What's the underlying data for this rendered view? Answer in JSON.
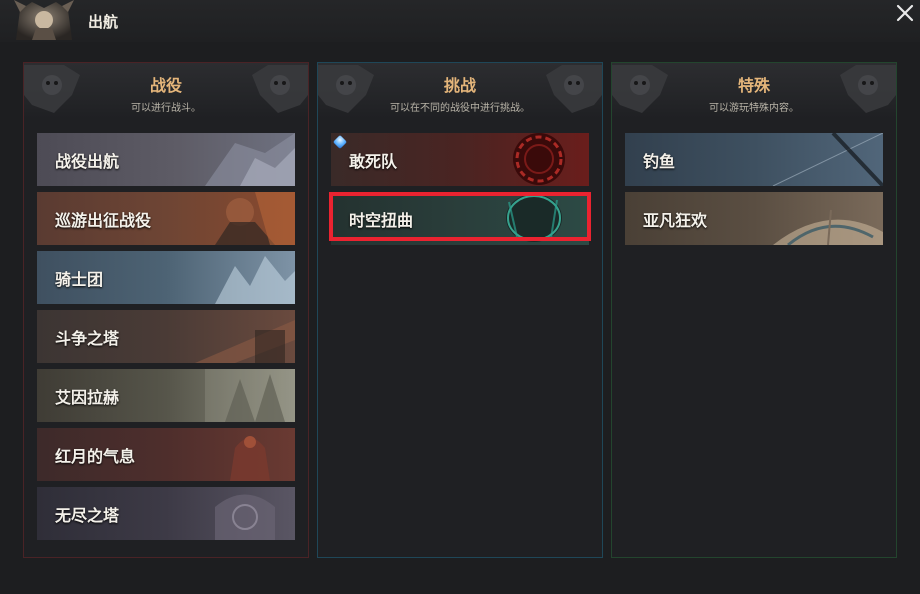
{
  "window": {
    "title": "出航"
  },
  "panels": [
    {
      "title": "战役",
      "subtitle": "可以进行战斗。",
      "items": [
        {
          "label": "战役出航"
        },
        {
          "label": "巡游出征战役"
        },
        {
          "label": "骑士团"
        },
        {
          "label": "斗争之塔"
        },
        {
          "label": "艾因拉赫"
        },
        {
          "label": "红月的气息"
        },
        {
          "label": "无尽之塔"
        }
      ]
    },
    {
      "title": "挑战",
      "subtitle": "可以在不同的战役中进行挑战。",
      "items": [
        {
          "label": "敢死队",
          "badge": "new-gem-icon"
        },
        {
          "label": "时空扭曲",
          "selected": true
        }
      ]
    },
    {
      "title": "特殊",
      "subtitle": "可以游玩特殊内容。",
      "items": [
        {
          "label": "钓鱼"
        },
        {
          "label": "亚凡狂欢"
        }
      ]
    }
  ],
  "colors": {
    "highlight": "#ea2330",
    "title_gold": "#e4b57a"
  }
}
